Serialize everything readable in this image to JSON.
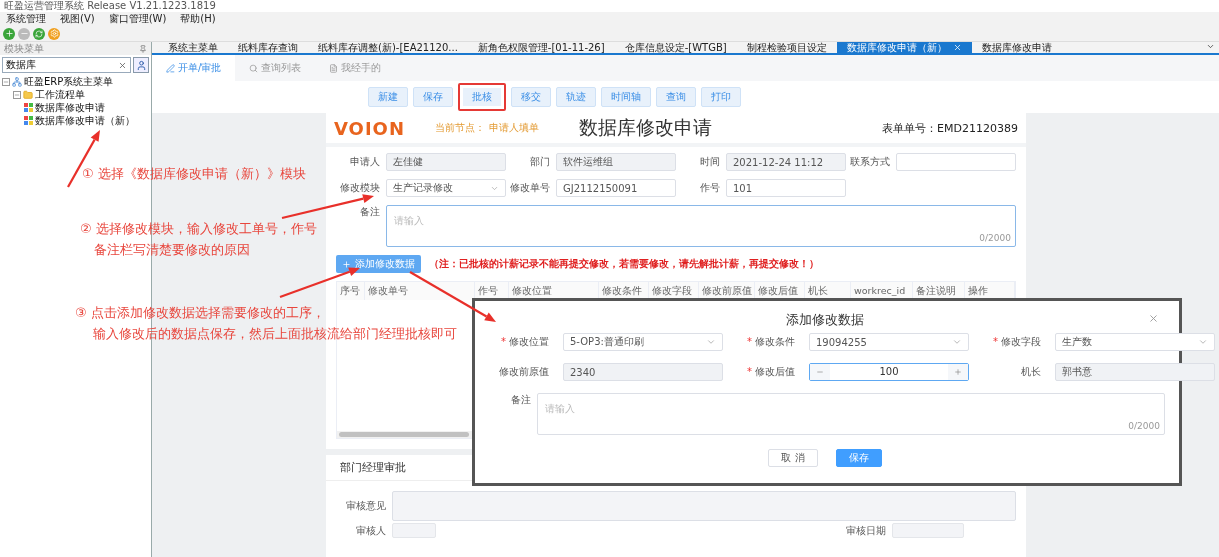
{
  "window": {
    "title": "旺盈运营管理系统 Release V1.21.1223.1819"
  },
  "menu": [
    "系统管理",
    "视图(V)",
    "窗口管理(W)",
    "帮助(H)"
  ],
  "sidebar": {
    "header": "模块菜单",
    "search": {
      "value": "数据库"
    },
    "tree": [
      {
        "label": "旺盈ERP系统主菜单",
        "kind": "root",
        "expanded": true,
        "children": [
          {
            "label": "工作流程单",
            "kind": "folder",
            "expanded": true,
            "children": [
              {
                "label": "数据库修改申请",
                "kind": "item"
              },
              {
                "label": "数据库修改申请（新）",
                "kind": "item"
              }
            ]
          }
        ]
      }
    ]
  },
  "tabs": [
    {
      "label": "系统主菜单",
      "selected": false
    },
    {
      "label": "纸料库存查询",
      "selected": false
    },
    {
      "label": "纸料库存调整(新)-[EA21120...",
      "selected": false
    },
    {
      "label": "新角色权限管理-[01-11-26]",
      "selected": false
    },
    {
      "label": "仓库信息设定-[WTGB]",
      "selected": false
    },
    {
      "label": "制程检验项目设定",
      "selected": false
    },
    {
      "label": "数据库修改申请（新）",
      "selected": true
    },
    {
      "label": "数据库修改申请",
      "selected": false
    }
  ],
  "subtabs": [
    {
      "label": "开单/审批",
      "selected": true
    },
    {
      "label": "查询列表",
      "selected": false
    },
    {
      "label": "我经手的",
      "selected": false
    }
  ],
  "actions": [
    {
      "label": "新建",
      "highlighted": false
    },
    {
      "label": "保存",
      "highlighted": false
    },
    {
      "label": "批核",
      "highlighted": true
    },
    {
      "label": "移交",
      "highlighted": false
    },
    {
      "label": "轨迹",
      "highlighted": false
    },
    {
      "label": "时间轴",
      "highlighted": false
    },
    {
      "label": "查询",
      "highlighted": false
    },
    {
      "label": "打印",
      "highlighted": false
    }
  ],
  "form": {
    "logo": "VOION",
    "node_label": "当前节点：",
    "node_value": "申请人填单",
    "title": "数据库修改申请",
    "number_label": "表单单号：",
    "number": "EMD21120389",
    "rows": [
      [
        {
          "label": "申请人",
          "value": "左佳健",
          "kind": "readonly"
        },
        {
          "label": "部门",
          "value": "软件运维组",
          "kind": "readonly"
        },
        {
          "label": "时间",
          "value": "2021-12-24 11:12",
          "kind": "readonly"
        },
        {
          "label": "联系方式",
          "kind": "input"
        }
      ],
      [
        {
          "label": "修改模块",
          "value": "生产记录修改",
          "kind": "select"
        },
        {
          "label": "修改单号",
          "value": "GJ2112150091",
          "kind": "input"
        },
        {
          "label": "作号",
          "value": "101",
          "kind": "input"
        }
      ]
    ],
    "remark": {
      "label": "备注",
      "placeholder": "请输入",
      "counter": "0/2000"
    },
    "add_button": "添加修改数据",
    "note": "（注：已批核的计薪记录不能再提交修改，若需要修改，请先解批计薪，再提交修改！）",
    "table": {
      "columns": [
        "序号",
        "修改单号",
        "作号",
        "修改位置",
        "修改条件",
        "修改字段",
        "修改前原值",
        "修改后值",
        "机长",
        "workrec_id",
        "备注说明",
        "操作"
      ]
    },
    "approval": {
      "title": "部门经理审批",
      "opinion_label": "审核意见",
      "approver_label": "审核人",
      "date_label": "审核日期"
    }
  },
  "dialog": {
    "title": "添加修改数据",
    "fields": [
      {
        "label": "修改位置",
        "value": "5-OP3:普通印刷",
        "marker": "*",
        "kind": "select"
      },
      {
        "label": "修改条件",
        "value": "19094255",
        "marker": "*",
        "kind": "select"
      },
      {
        "label": "修改字段",
        "value": "生产数",
        "marker": "*",
        "kind": "select"
      },
      {
        "label": "修改前原值",
        "value": "2340",
        "kind": "readonly"
      },
      {
        "label": "修改后值",
        "value": "100",
        "marker": "*",
        "kind": "number"
      },
      {
        "label": "机长",
        "value": "郭书意",
        "kind": "readonly"
      }
    ],
    "remark": {
      "label": "备注",
      "placeholder": "请输入",
      "counter": "0/2000"
    },
    "buttons": [
      {
        "label": "取 消",
        "kind": "default"
      },
      {
        "label": "保存",
        "kind": "primary"
      }
    ]
  },
  "annotations": [
    {
      "lines": [
        "① 选择《数据库修改申请（新）》模块"
      ]
    },
    {
      "lines": [
        "② 选择修改模块，输入修改工单号，作号",
        "备注栏写清楚要修改的原因"
      ]
    },
    {
      "lines": [
        "③ 点击添加修改数据选择需要修改的工序，",
        "输入修改后的数据点保存，然后上面批核流给部门经理批核即可"
      ]
    }
  ]
}
